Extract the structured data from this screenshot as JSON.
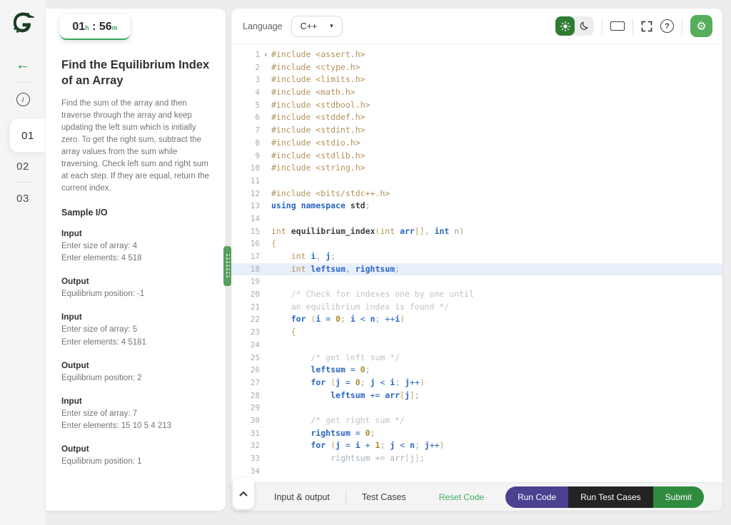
{
  "colors": {
    "accent_green": "#2f9e4f",
    "timer_underline": "#3aa55c",
    "sun_button_bg": "#2e7d32",
    "gear_button_bg": "#56ae5c",
    "grip_green": "#57a05e",
    "run_code_bg": "#4a4191",
    "run_tests_bg": "#232323",
    "submit_bg": "#2f8b3e",
    "reset_link": "#3fae5f",
    "highlight_line_bg": "#e9eefb"
  },
  "rail": {
    "logo": "crocodile-logo",
    "back_arrow": "←",
    "info": "i",
    "tabs": [
      {
        "label": "01",
        "active": true
      },
      {
        "label": "02",
        "active": false
      },
      {
        "label": "03",
        "active": false
      }
    ]
  },
  "timer": {
    "hours": "01",
    "hours_unit": "h",
    "separator": ":",
    "minutes": "56",
    "minutes_unit": "m"
  },
  "problem": {
    "title": "Find the Equilibrium Index of an Array",
    "description": "Find the sum of the array and then traverse through the array and keep updating the left sum which is initially zero. To get the right sum, subtract the array values from the sum while traversing. Check left sum and right sum at each step. If they are equal, return the current index.",
    "sample_io_heading": "Sample I/O",
    "blocks": [
      {
        "label": "Input",
        "lines": [
          "Enter size of array: 4",
          "Enter elements: 4 518"
        ]
      },
      {
        "label": "Output",
        "lines": [
          "Equilibrium position: -1"
        ]
      },
      {
        "label": "Input",
        "lines": [
          "Enter size of array: 5",
          "Enter elements: 4 5181"
        ]
      },
      {
        "label": "Output",
        "lines": [
          "Equilibrium position: 2"
        ]
      },
      {
        "label": "Input",
        "lines": [
          "Enter size of array: 7",
          "Enter elements: 15 10 5 4 213"
        ]
      },
      {
        "label": "Output",
        "lines": [
          "Equilibrium position: 1"
        ]
      }
    ]
  },
  "editor_header": {
    "language_label": "Language",
    "language_value": "C++",
    "caret": "▾",
    "icons": [
      "sun-icon",
      "moon-icon",
      "window-icon",
      "fullscreen-icon",
      "help-icon",
      "gear-icon"
    ],
    "help_glyph": "?",
    "gear_glyph": "⚙"
  },
  "editor": {
    "highlight_line": 18,
    "fold_lines": [
      1
    ],
    "fold_glyph": "›",
    "lines": [
      [
        [
          "inc",
          "#include <assert.h>"
        ]
      ],
      [
        [
          "inc",
          "#include <ctype.h>"
        ]
      ],
      [
        [
          "inc",
          "#include <limits.h>"
        ]
      ],
      [
        [
          "inc",
          "#include <math.h>"
        ]
      ],
      [
        [
          "inc",
          "#include <stdbool.h>"
        ]
      ],
      [
        [
          "inc",
          "#include <stddef.h>"
        ]
      ],
      [
        [
          "inc",
          "#include <stdint.h>"
        ]
      ],
      [
        [
          "inc",
          "#include <stdio.h>"
        ]
      ],
      [
        [
          "inc",
          "#include <stdlib.h>"
        ]
      ],
      [
        [
          "inc",
          "#include <string.h>"
        ]
      ],
      [],
      [
        [
          "inc",
          "#include <bits/stdc++.h>"
        ]
      ],
      [
        [
          "kw",
          "using"
        ],
        [
          "pln",
          " "
        ],
        [
          "kw",
          "namespace"
        ],
        [
          "pln",
          " "
        ],
        [
          "dk",
          "std"
        ],
        [
          "pun",
          ";"
        ]
      ],
      [],
      [
        [
          "inc",
          "int"
        ],
        [
          "pln",
          " "
        ],
        [
          "dk",
          "equilibrium_index"
        ],
        [
          "gp",
          "("
        ],
        [
          "inc",
          "int"
        ],
        [
          "pln",
          " "
        ],
        [
          "id",
          "arr"
        ],
        [
          "gp",
          "[]"
        ],
        [
          "pun",
          ", "
        ],
        [
          "kw",
          "int"
        ],
        [
          "pln",
          " "
        ],
        [
          "pun",
          "n"
        ],
        [
          "gp",
          ")"
        ]
      ],
      [
        [
          "gp",
          "{"
        ]
      ],
      [
        [
          "pln",
          "    "
        ],
        [
          "inc",
          "int"
        ],
        [
          "pln",
          " "
        ],
        [
          "id",
          "i"
        ],
        [
          "pun",
          ", "
        ],
        [
          "id",
          "j"
        ],
        [
          "pun",
          ";"
        ]
      ],
      [
        [
          "pln",
          "    "
        ],
        [
          "inc",
          "int"
        ],
        [
          "pln",
          " "
        ],
        [
          "id",
          "leftsum"
        ],
        [
          "pun",
          ", "
        ],
        [
          "id",
          "rightsum"
        ],
        [
          "pun",
          ";"
        ]
      ],
      [],
      [
        [
          "pln",
          "    "
        ],
        [
          "cmt",
          "/* Check for indexes one by one until"
        ]
      ],
      [
        [
          "pln",
          "    "
        ],
        [
          "cmt",
          "an equilibrium index is found */"
        ]
      ],
      [
        [
          "pln",
          "    "
        ],
        [
          "kw",
          "for"
        ],
        [
          "pln",
          " "
        ],
        [
          "gp",
          "("
        ],
        [
          "id",
          "i"
        ],
        [
          "op",
          " = "
        ],
        [
          "num",
          "0"
        ],
        [
          "pun",
          "; "
        ],
        [
          "id",
          "i"
        ],
        [
          "op",
          " < "
        ],
        [
          "id",
          "n"
        ],
        [
          "pun",
          "; "
        ],
        [
          "op",
          "++"
        ],
        [
          "id",
          "i"
        ],
        [
          "gp",
          ")"
        ]
      ],
      [
        [
          "pln",
          "    "
        ],
        [
          "gp",
          "{"
        ]
      ],
      [],
      [
        [
          "pln",
          "        "
        ],
        [
          "cmt",
          "/* get left sum */"
        ]
      ],
      [
        [
          "pln",
          "        "
        ],
        [
          "id",
          "leftsum"
        ],
        [
          "op",
          " = "
        ],
        [
          "num",
          "0"
        ],
        [
          "pun",
          ";"
        ]
      ],
      [
        [
          "pln",
          "        "
        ],
        [
          "kw",
          "for"
        ],
        [
          "pln",
          " "
        ],
        [
          "gp",
          "("
        ],
        [
          "id",
          "j"
        ],
        [
          "op",
          " = "
        ],
        [
          "num",
          "0"
        ],
        [
          "pun",
          "; "
        ],
        [
          "id",
          "j"
        ],
        [
          "op",
          " < "
        ],
        [
          "id",
          "i"
        ],
        [
          "pun",
          "; "
        ],
        [
          "id",
          "j"
        ],
        [
          "op",
          "++"
        ],
        [
          "gp",
          ")"
        ]
      ],
      [
        [
          "pln",
          "            "
        ],
        [
          "id",
          "leftsum"
        ],
        [
          "op",
          " += "
        ],
        [
          "id",
          "arr"
        ],
        [
          "gp",
          "["
        ],
        [
          "id",
          "j"
        ],
        [
          "gp",
          "]"
        ],
        [
          "pun",
          ";"
        ]
      ],
      [],
      [
        [
          "pln",
          "        "
        ],
        [
          "cmt",
          "/* get right sum */"
        ]
      ],
      [
        [
          "pln",
          "        "
        ],
        [
          "id",
          "rightsum"
        ],
        [
          "op",
          " = "
        ],
        [
          "num",
          "0"
        ],
        [
          "pun",
          ";"
        ]
      ],
      [
        [
          "pln",
          "        "
        ],
        [
          "kw",
          "for"
        ],
        [
          "pln",
          " "
        ],
        [
          "gp",
          "("
        ],
        [
          "id",
          "j"
        ],
        [
          "op",
          " = "
        ],
        [
          "id",
          "i"
        ],
        [
          "op",
          " + "
        ],
        [
          "num",
          "1"
        ],
        [
          "pun",
          "; "
        ],
        [
          "id",
          "j"
        ],
        [
          "op",
          " < "
        ],
        [
          "id",
          "n"
        ],
        [
          "pun",
          "; "
        ],
        [
          "id",
          "j"
        ],
        [
          "op",
          "++"
        ],
        [
          "gp",
          ")"
        ]
      ],
      [
        [
          "pln",
          "            "
        ],
        [
          "fade",
          "rightsum += arr"
        ],
        [
          "fgp",
          "["
        ],
        [
          "fade",
          "j"
        ],
        [
          "fgp",
          "]"
        ],
        [
          "fade",
          ";"
        ]
      ],
      []
    ]
  },
  "footer": {
    "collapse": "^",
    "tabs": [
      "Input & output",
      "Test Cases"
    ],
    "reset_label": "Reset Code",
    "run_label": "Run Code",
    "run_tests_label": "Run Test Cases",
    "submit_label": "Submit"
  }
}
